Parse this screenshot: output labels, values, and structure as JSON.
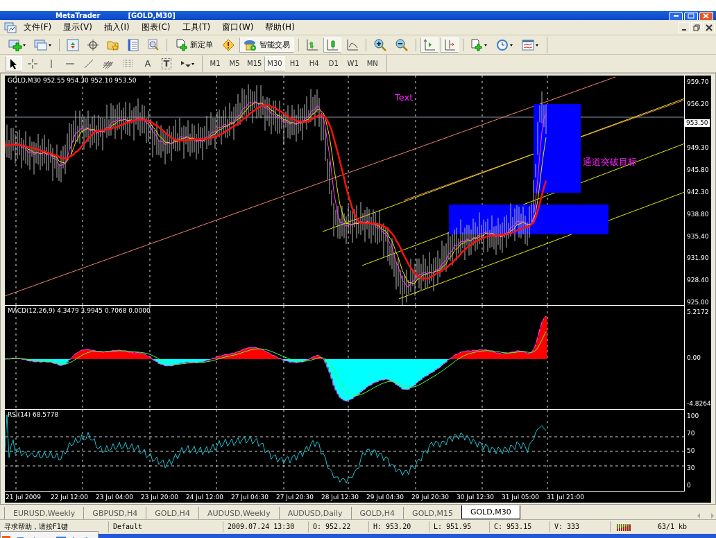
{
  "window": {
    "title_parts": [
      "MetaTrader",
      "[GOLD,M30]"
    ]
  },
  "menu": [
    "文件(F)",
    "显示(V)",
    "插入(I)",
    "图表(C)",
    "工具(T)",
    "窗口(W)",
    "帮助(H)"
  ],
  "toolbar": {
    "new_order": "新定单",
    "expert_advisors": "智能交易",
    "expert_on": true,
    "chart_types": [
      {
        "kind": "bars",
        "selected": false
      },
      {
        "kind": "candles",
        "selected": true
      },
      {
        "kind": "line",
        "selected": false
      }
    ],
    "auto_scroll": {
      "on": true
    },
    "chart_shift": {
      "on": true
    }
  },
  "drawing_tools": [
    {
      "kind": "cursor",
      "selected": true
    },
    {
      "kind": "crosshair",
      "selected": false
    },
    {
      "kind": "vline",
      "selected": false
    },
    {
      "kind": "hline",
      "selected": false
    },
    {
      "kind": "trend",
      "selected": false
    },
    {
      "kind": "channel",
      "selected": false
    },
    {
      "kind": "fibo",
      "selected": false
    },
    {
      "kind": "text",
      "label": "A",
      "selected": false
    },
    {
      "kind": "label",
      "label": "T",
      "selected": false
    },
    {
      "kind": "arrows",
      "selected": false
    }
  ],
  "timeframes": [
    {
      "label": "M1",
      "selected": false
    },
    {
      "label": "M5",
      "selected": false
    },
    {
      "label": "M15",
      "selected": false
    },
    {
      "label": "M30",
      "selected": true
    },
    {
      "label": "H1",
      "selected": false
    },
    {
      "label": "H4",
      "selected": false
    },
    {
      "label": "D1",
      "selected": false
    },
    {
      "label": "W1",
      "selected": false
    },
    {
      "label": "MN",
      "selected": false
    }
  ],
  "chart": {
    "header": "GOLD,M30  952.55 954.30 952.10 953.50",
    "price_axis": [
      "959.70",
      "956.20",
      "949.30",
      "945.80",
      "942.30",
      "938.80",
      "935.40",
      "931.90",
      "928.40",
      "925.00"
    ],
    "current_price": "953.50",
    "annotations": [
      {
        "text": "Text"
      },
      {
        "text": "通道突破目标"
      }
    ]
  },
  "macd": {
    "header": "MACD(12,26,9) 4.3479 3.9945 0.7068 0.0000",
    "axis": [
      "5.2172",
      "0.00",
      "-4.8264"
    ]
  },
  "rsi": {
    "header": "RSI(14) 68.5778",
    "axis": [
      "100",
      "70",
      "50",
      "30",
      "0"
    ]
  },
  "time_axis": [
    "21 Jul 2009",
    "22 Jul 12:00",
    "23 Jul 04:00",
    "23 Jul 20:00",
    "24 Jul 12:00",
    "27 Jul 04:30",
    "27 Jul 20:30",
    "28 Jul 12:30",
    "29 Jul 04:30",
    "29 Jul 20:30",
    "30 Jul 12:30",
    "31 Jul 05:00",
    "31 Jul 21:00"
  ],
  "tabs": [
    {
      "label": "EURUSD,Weekly",
      "selected": false
    },
    {
      "label": "GBPUSD,H4",
      "selected": false
    },
    {
      "label": "GOLD,H4",
      "selected": false
    },
    {
      "label": "AUDUSD,Weekly",
      "selected": false
    },
    {
      "label": "AUDUSD,Daily",
      "selected": false
    },
    {
      "label": "GOLD,H4",
      "selected": false
    },
    {
      "label": "GOLD,M15",
      "selected": false
    },
    {
      "label": "GOLD,M30",
      "selected": true
    }
  ],
  "status_bar": {
    "help": "寻求帮助，请按F1键",
    "profile": "Default",
    "time": "2009.07.24 13:30",
    "open": "O: 952.22",
    "high": "H: 953.20",
    "low": "L: 951.95",
    "close": "C: 953.15",
    "volume": "V: 333",
    "traffic": "63/1 kb"
  }
}
